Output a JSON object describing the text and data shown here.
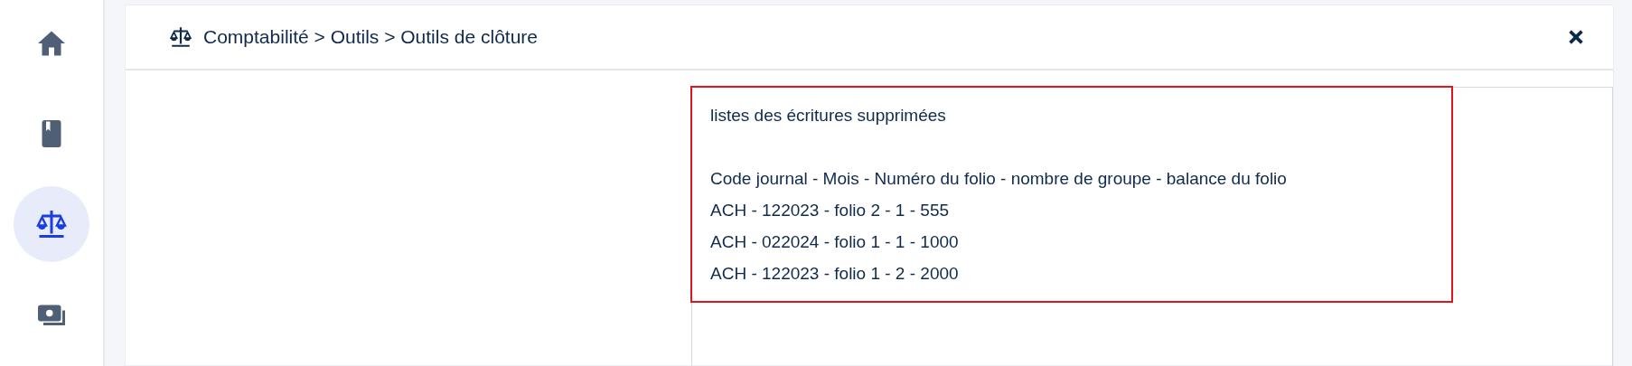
{
  "sidebar": {
    "items": [
      {
        "kind": "home",
        "selected": false
      },
      {
        "kind": "book",
        "selected": false
      },
      {
        "kind": "scale",
        "selected": true
      },
      {
        "kind": "money",
        "selected": false
      }
    ]
  },
  "header": {
    "breadcrumb": "Comptabilité > Outils > Outils de clôture"
  },
  "content": {
    "title": "listes des écritures supprimées",
    "lines": [
      "Code journal - Mois - Numéro du folio - nombre de groupe - balance du folio",
      "ACH - 122023 - folio 2 - 1 - 555",
      "ACH - 022024 - folio 1 - 1 - 1000",
      "ACH - 122023 - folio 1 - 2 - 2000"
    ]
  }
}
